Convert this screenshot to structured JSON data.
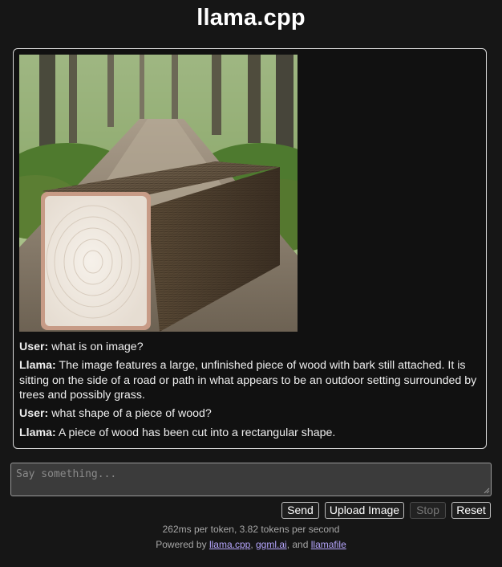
{
  "app": {
    "title": "llama.cpp"
  },
  "chat": {
    "messages": [
      {
        "role": "User:",
        "text": "what is on image?"
      },
      {
        "role": "Llama:",
        "text": "The image features a large, unfinished piece of wood with bark still attached. It is sitting on the side of a road or path in what appears to be an outdoor setting surrounded by trees and possibly grass."
      },
      {
        "role": "User:",
        "text": "what shape of a piece of wood?"
      },
      {
        "role": "Llama:",
        "text": "A piece of wood has been cut into a rectangular shape."
      }
    ]
  },
  "input": {
    "placeholder": "Say something...",
    "value": ""
  },
  "buttons": {
    "send": "Send",
    "upload": "Upload Image",
    "stop": "Stop",
    "reset": "Reset"
  },
  "footer": {
    "stats": "262ms per token, 3.82 tokens per second",
    "powered_prefix": "Powered by",
    "link1": "llama.cpp",
    "sep1": ",",
    "link2": "ggml.ai",
    "sep2": ", and",
    "link3": "llamafile"
  },
  "colors": {
    "background": "#161616",
    "panel_border": "#d9d9d9",
    "link": "#b7a7ff",
    "input_bg": "#3b3b3b"
  }
}
